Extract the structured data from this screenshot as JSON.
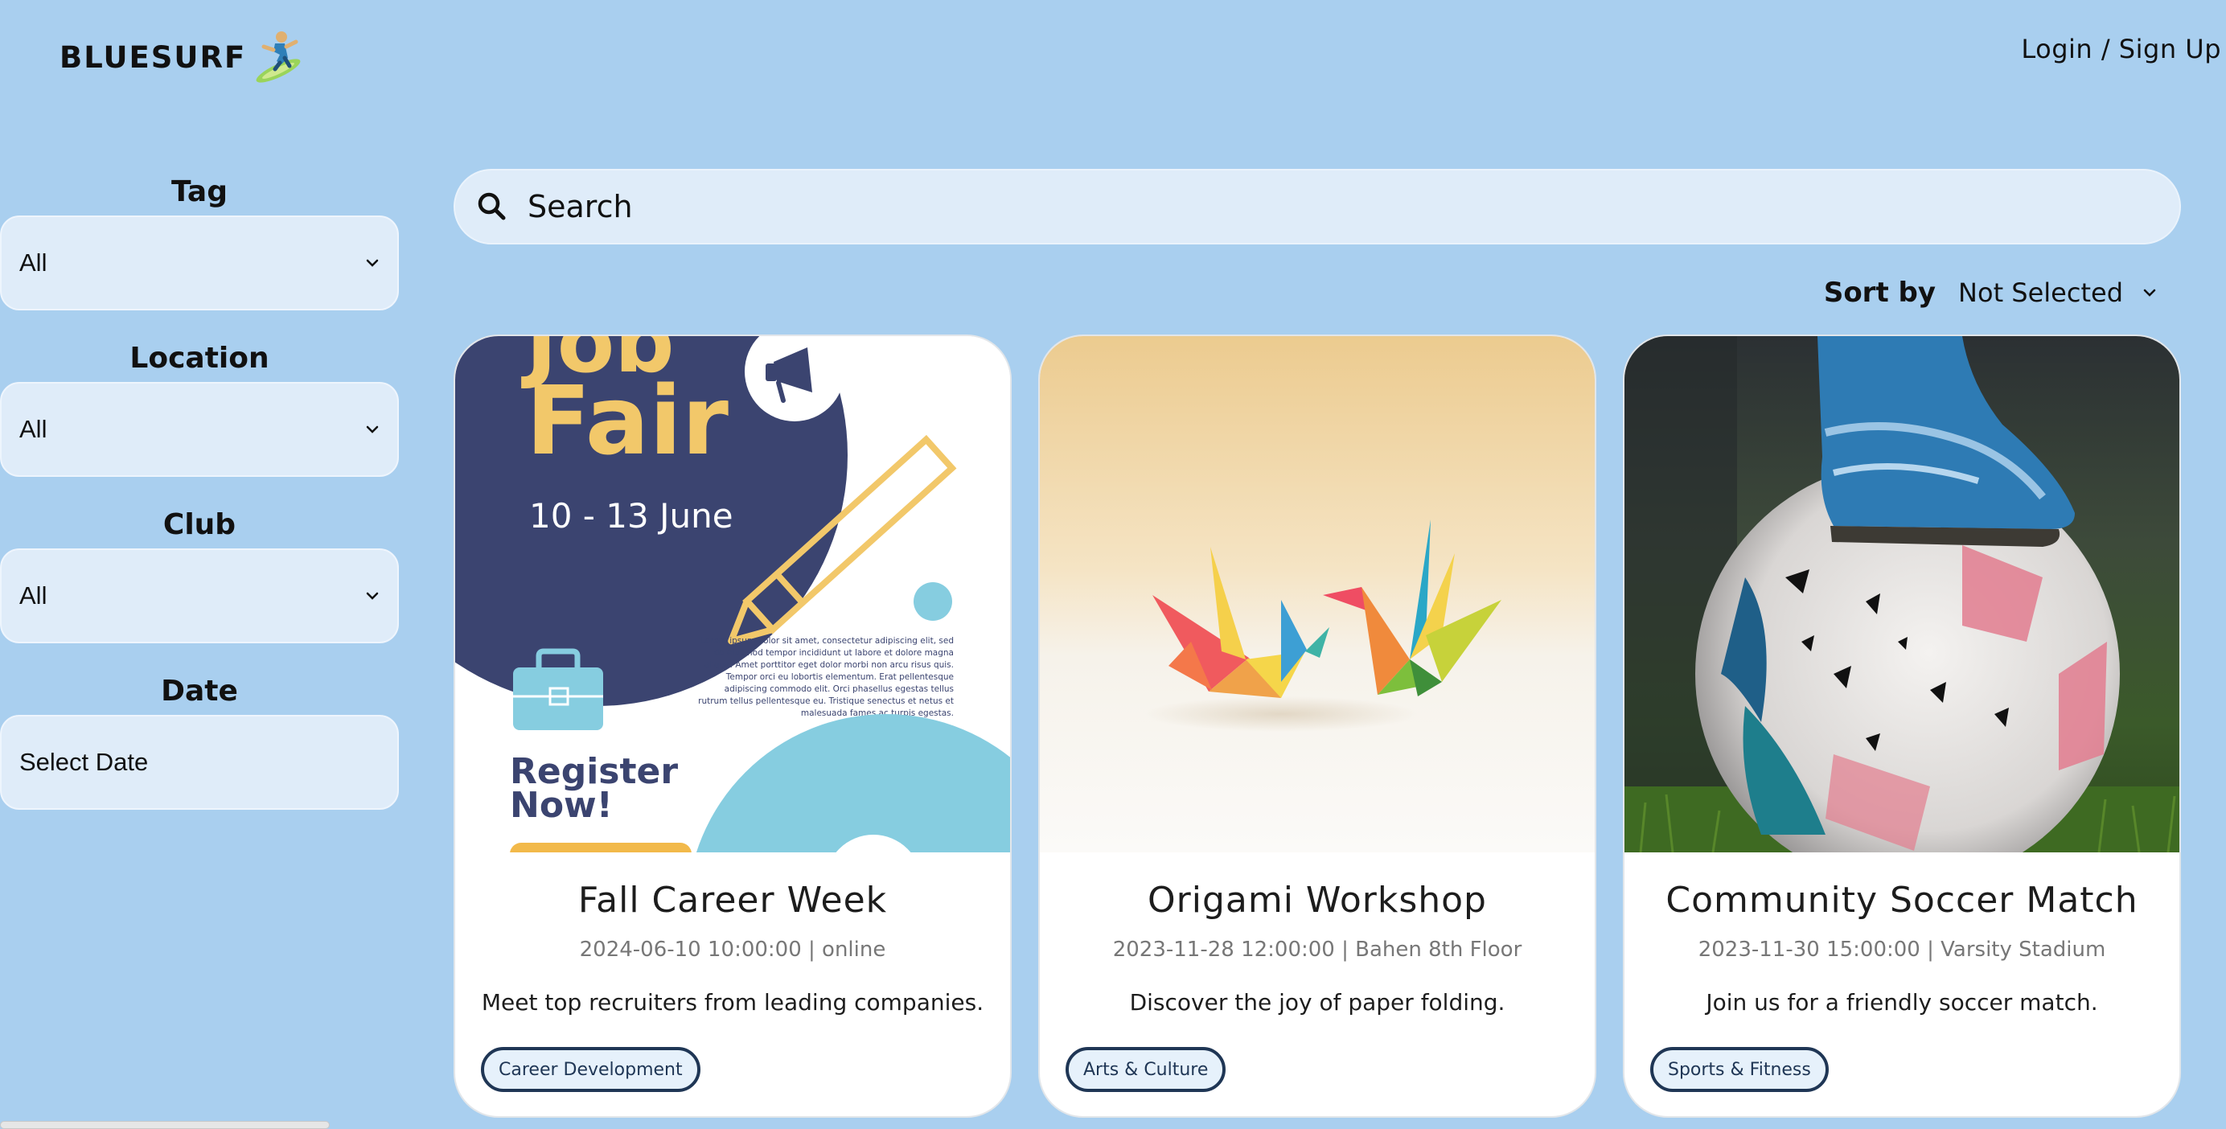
{
  "header": {
    "brand": "BLUESURF",
    "login_label": "Login / Sign Up"
  },
  "filters": {
    "tag": {
      "label": "Tag",
      "value": "All"
    },
    "location": {
      "label": "Location",
      "value": "All"
    },
    "club": {
      "label": "Club",
      "value": "All"
    },
    "date": {
      "label": "Date",
      "value": "Select Date"
    }
  },
  "search": {
    "placeholder": "Search"
  },
  "sort": {
    "label": "Sort by",
    "value": "Not Selected"
  },
  "events": [
    {
      "title": "Fall Career Week",
      "meta": "2024-06-10 10:00:00 | online",
      "description": "Meet top recruiters from leading companies.",
      "tag": "Career Development",
      "poster": {
        "headline_line1": "Job",
        "headline_line2": "Fair",
        "dates": "10 - 13 June",
        "cta_line1": "Register",
        "cta_line2": "Now!",
        "body_lines": [
          "Lorem ipsum dolor sit amet, consectetur adipiscing elit, sed",
          "do eiusmod tempor incididunt ut labore et dolore magna",
          "aliqua. Amet porttitor eget dolor morbi non arcu risus quis.",
          "Tempor orci eu lobortis elementum. Erat pellentesque",
          "adipiscing commodo elit. Orci phasellus egestas tellus",
          "rutrum tellus pellentesque eu. Tristique senectus et netus et",
          "malesuada fames ac turpis egestas."
        ]
      }
    },
    {
      "title": "Origami Workshop",
      "meta": "2023-11-28 12:00:00 | Bahen 8th Floor",
      "description": "Discover the joy of paper folding.",
      "tag": "Arts & Culture"
    },
    {
      "title": "Community Soccer Match",
      "meta": "2023-11-30 15:00:00 | Varsity Stadium",
      "description": "Join us for a friendly soccer match.",
      "tag": "Sports & Fitness"
    }
  ],
  "colors": {
    "background": "#a9cfef",
    "field": "#dfecf9",
    "tag_border": "#1f3655",
    "poster_navy": "#3b4470",
    "poster_yellow": "#f2c86a",
    "poster_cyan": "#86cde0"
  },
  "icons": {
    "logo": "surfer-icon",
    "search": "search-icon",
    "dropdown": "chevron-down-icon"
  }
}
